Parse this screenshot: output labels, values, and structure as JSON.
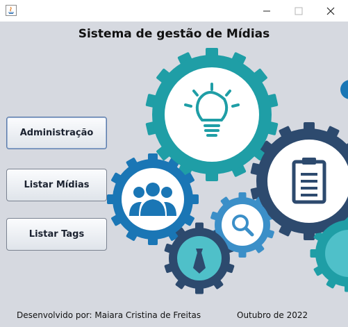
{
  "window": {
    "minimize_glyph": "—",
    "maximize_glyph": "☐",
    "close_glyph": "✕"
  },
  "header": {
    "title": "Sistema de gestão de Mídias"
  },
  "buttons": {
    "administracao": "Administração",
    "listar_midias": "Listar Mídias",
    "listar_tags": "Listar Tags"
  },
  "footer": {
    "developer": "Desenvolvido por: Maiara Cristina de Freitas",
    "date": "Outubro de 2022"
  },
  "colors": {
    "background": "#d6d9e0",
    "teal": "#1f9ea6",
    "blue": "#1a76b5",
    "navy": "#2d4a6e",
    "light_blue": "#3b8fc8",
    "aqua": "#4fc0c9"
  }
}
